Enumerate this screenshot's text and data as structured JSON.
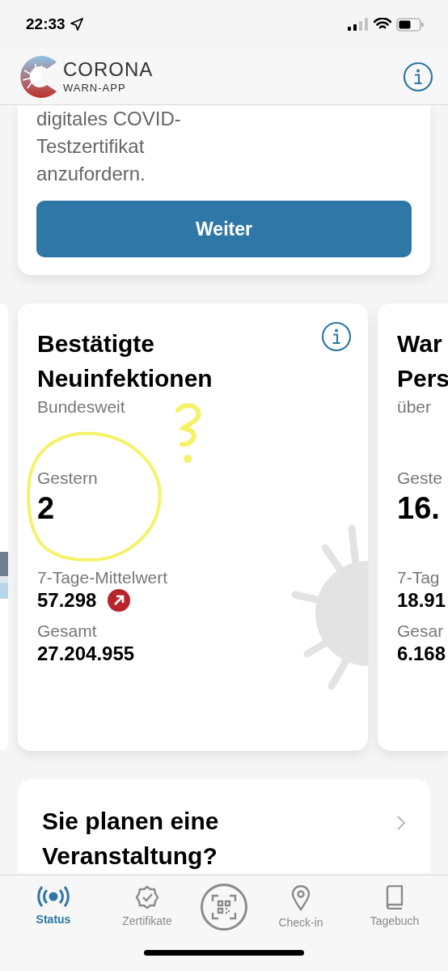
{
  "status_bar": {
    "time": "22:33"
  },
  "header": {
    "logo_title": "CORONA",
    "logo_subtitle": "WARN-APP"
  },
  "test_card": {
    "text": "digitales COVID-\nTestzertifikat\nanzufordern.",
    "button": "Weiter"
  },
  "stat_cards": [
    {
      "title": "Bestätigte\nNeuinfektionen",
      "subtitle": "Bundesweit",
      "info_button": true,
      "yesterday_label": "Gestern",
      "yesterday_value": "2",
      "average_label": "7-Tage-Mittelwert",
      "average_value": "57.298",
      "trend_up": true,
      "total_label": "Gesamt",
      "total_value": "27.204.955"
    },
    {
      "title": "War\nPers",
      "subtitle": "über",
      "info_button": false,
      "yesterday_label": "Geste",
      "yesterday_value": "16.",
      "average_label": "7-Tag",
      "average_value": "18.91",
      "total_label": "Gesar",
      "total_value": "6.168"
    }
  ],
  "annotation": {
    "kind": "scribble"
  },
  "event_card": {
    "title": "Sie planen eine Veranstaltung?"
  },
  "tabs": [
    {
      "kind": "tab",
      "label": "Status",
      "selected": true
    },
    {
      "kind": "tab",
      "label": "Zertifikate",
      "selected": false
    },
    {
      "kind": "scan"
    },
    {
      "kind": "tab",
      "label": "Check-in",
      "selected": false
    },
    {
      "kind": "tab",
      "label": "Tagebuch",
      "selected": false
    }
  ]
}
